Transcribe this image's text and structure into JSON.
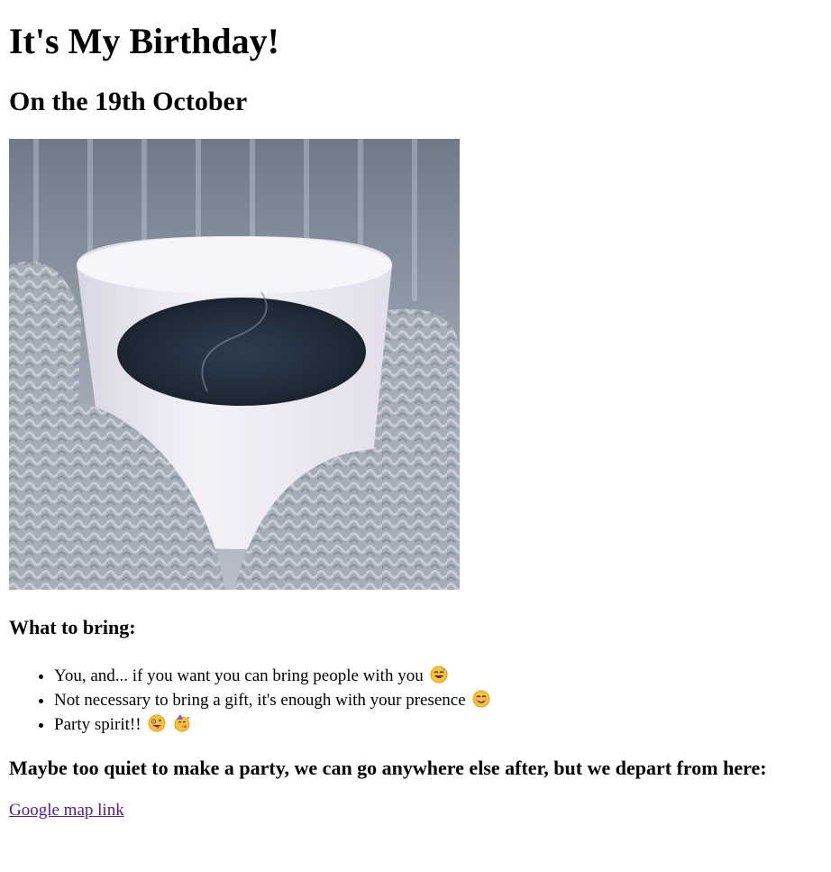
{
  "title": "It's My Birthday!",
  "date_heading": "On the 19th October",
  "image": {
    "alt": "coffee-cup-held-in-knitted-mittens"
  },
  "bring": {
    "heading": "What to bring:",
    "items": [
      {
        "text": "You, and... if you want you can bring people with you",
        "emojis": [
          "grinning-sweat-emoji"
        ]
      },
      {
        "text": "Not necessary to bring a gift, it's enough with your presence",
        "emojis": [
          "smiling-blush-emoji"
        ]
      },
      {
        "text": "Party spirit!!",
        "emojis": [
          "zany-face-emoji",
          "party-face-emoji"
        ]
      }
    ]
  },
  "depart_heading": "Maybe too quiet to make a party, we can go anywhere else after, but we depart from here:",
  "map_link": {
    "label": "Google map link"
  },
  "colors": {
    "visited_link": "#551a8b",
    "text": "#000000",
    "background": "#ffffff"
  }
}
